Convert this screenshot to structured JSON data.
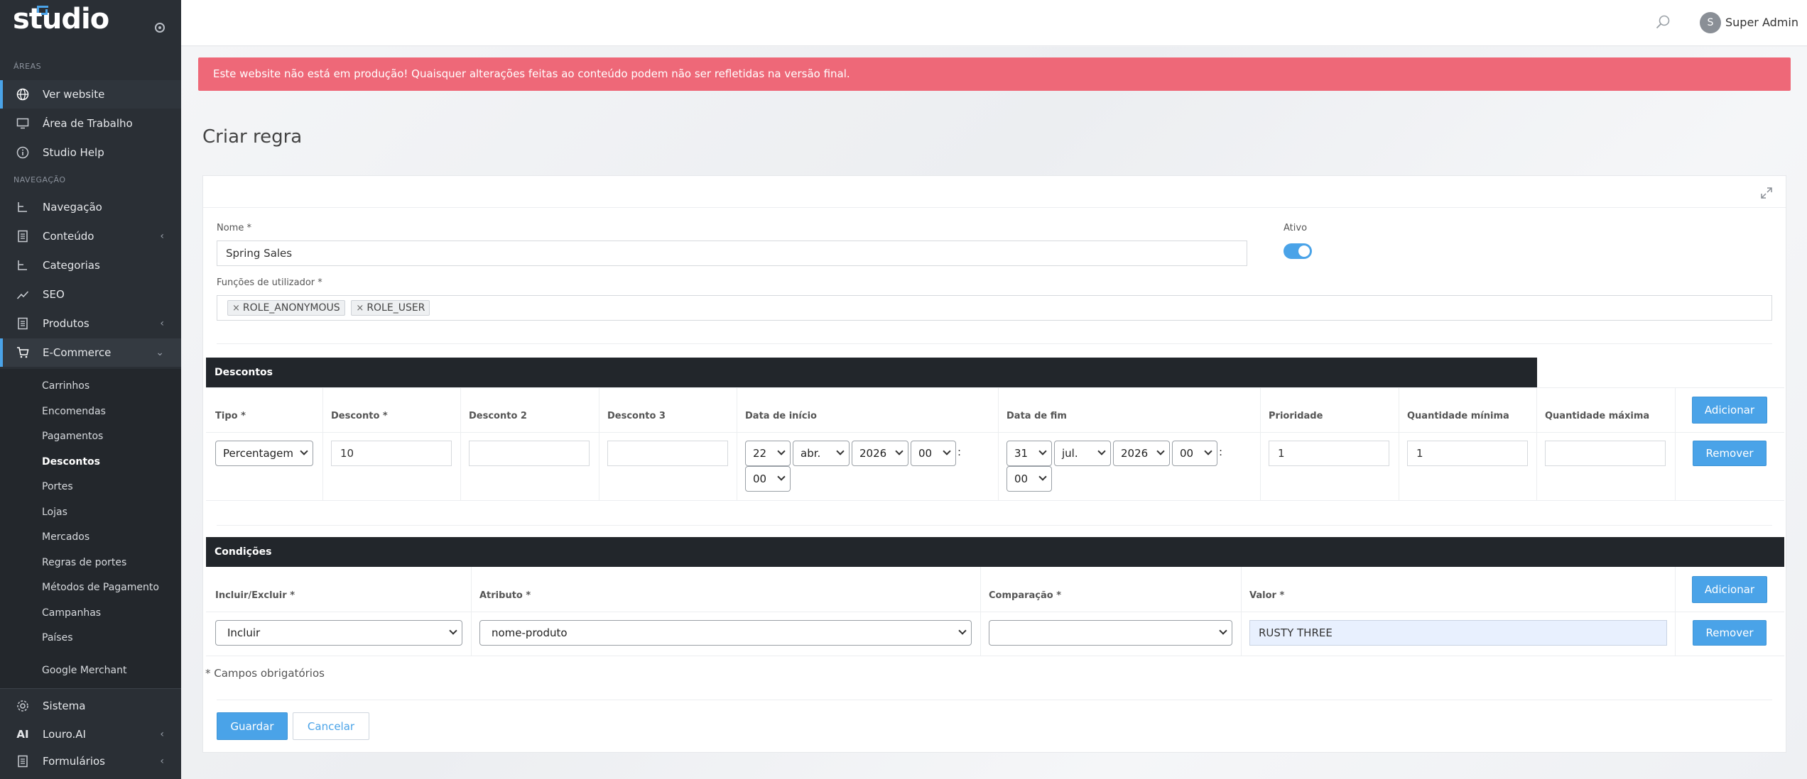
{
  "sidebar": {
    "logo": "studio",
    "sections": {
      "areas": "ÁREAS",
      "navigation": "NAVEGAÇÃO"
    },
    "items": [
      {
        "label": "Ver website",
        "icon": "globe-icon"
      },
      {
        "label": "Área de Trabalho",
        "icon": "monitor-icon"
      },
      {
        "label": "Studio Help",
        "icon": "info-icon"
      },
      {
        "label": "Navegação",
        "icon": "tree-icon"
      },
      {
        "label": "Conteúdo",
        "icon": "document-icon"
      },
      {
        "label": "Categorias",
        "icon": "tree-icon"
      },
      {
        "label": "SEO",
        "icon": "chart-line-icon"
      },
      {
        "label": "Produtos",
        "icon": "document-icon"
      },
      {
        "label": "E-Commerce",
        "icon": "cart-icon"
      }
    ],
    "submenu": [
      "Carrinhos",
      "Encomendas",
      "Pagamentos",
      "Descontos",
      "Portes",
      "Lojas",
      "Mercados",
      "Regras de portes",
      "Métodos de Pagamento",
      "Campanhas",
      "Países",
      "Google Merchant"
    ],
    "bottom_items": [
      {
        "label": "Sistema",
        "icon": "gear-icon"
      },
      {
        "label": "Louro.AI",
        "icon": "ai-icon"
      },
      {
        "label": "Formulários",
        "icon": "document-icon"
      }
    ]
  },
  "topbar": {
    "avatar_initial": "S",
    "user_name": "Super Admin"
  },
  "alert": "Este website não está em produção! Quaisquer alterações feitas ao conteúdo podem não ser refletidas na versão final.",
  "page_title": "Criar regra",
  "form": {
    "name_label": "Nome *",
    "name_value": "Spring Sales",
    "active_label": "Ativo",
    "active": true,
    "roles_label": "Funções de utilizador *",
    "roles": [
      "ROLE_ANONYMOUS",
      "ROLE_USER"
    ],
    "tag_remove": "×"
  },
  "discounts": {
    "header": "Descontos",
    "columns": [
      "Tipo *",
      "Desconto *",
      "Desconto 2",
      "Desconto 3",
      "Data de início",
      "Data de fim",
      "Prioridade",
      "Quantidade mínima",
      "Quantidade máxima"
    ],
    "add_label": "Adicionar",
    "remove_label": "Remover",
    "row": {
      "type": "Percentagem",
      "discount": "10",
      "discount2": "",
      "discount3": "",
      "start": {
        "day": "22",
        "month": "abr.",
        "year": "2026",
        "hour": "00",
        "minute": "00"
      },
      "end": {
        "day": "31",
        "month": "jul.",
        "year": "2026",
        "hour": "00",
        "minute": "00"
      },
      "priority": "1",
      "min_qty": "1",
      "max_qty": ""
    },
    "time_sep": ":"
  },
  "conditions": {
    "header": "Condições",
    "columns": [
      "Incluir/Excluir *",
      "Atributo *",
      "Comparação *",
      "Valor *"
    ],
    "add_label": "Adicionar",
    "remove_label": "Remover",
    "row": {
      "include": "Incluir",
      "attribute": "nome-produto",
      "comparison": "",
      "value": "RUSTY THREE"
    }
  },
  "required_note": "* Campos obrigatórios",
  "actions": {
    "save": "Guardar",
    "cancel": "Cancelar"
  }
}
